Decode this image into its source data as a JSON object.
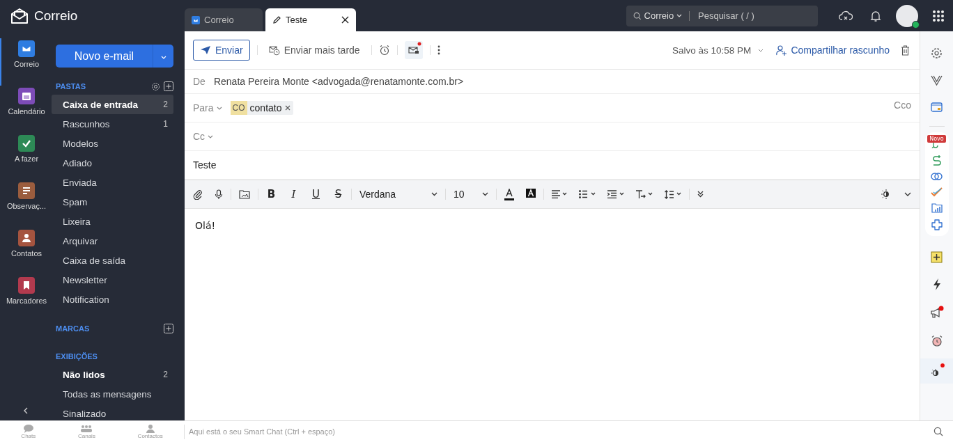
{
  "app": {
    "title": "Correio"
  },
  "tabs": [
    {
      "label": "Correio",
      "kind": "app",
      "selected": false
    },
    {
      "label": "Teste",
      "kind": "draft",
      "selected": true
    }
  ],
  "search": {
    "scope": "Correio",
    "placeholder": "Pesquisar ( / )"
  },
  "nav": [
    {
      "label": "Correio",
      "kind": "mail",
      "color": "#2f7de1",
      "selected": true
    },
    {
      "label": "Calendário",
      "kind": "calendar",
      "color": "#7d4cb8",
      "selected": false
    },
    {
      "label": "A fazer",
      "kind": "todo",
      "color": "#2d8a56",
      "selected": false
    },
    {
      "label": "Observaç...",
      "kind": "notes",
      "color": "#9b5d3e",
      "selected": false
    },
    {
      "label": "Contatos",
      "kind": "contacts",
      "color": "#a5543f",
      "selected": false
    },
    {
      "label": "Marcadores",
      "kind": "bookmarks",
      "color": "#b23a4e",
      "selected": false
    }
  ],
  "new_button": "Novo e-mail",
  "folders": {
    "title": "PASTAS",
    "items": [
      {
        "label": "Caixa de entrada",
        "count": "2",
        "unread": true,
        "selected": true
      },
      {
        "label": "Rascunhos",
        "count": "1",
        "unread": false,
        "selected": false
      },
      {
        "label": "Modelos",
        "unread": false,
        "selected": false
      },
      {
        "label": "Adiado",
        "unread": false,
        "selected": false
      },
      {
        "label": "Enviada",
        "unread": false,
        "selected": false
      },
      {
        "label": "Spam",
        "unread": false,
        "selected": false
      },
      {
        "label": "Lixeira",
        "unread": false,
        "selected": false
      },
      {
        "label": "Arquivar",
        "unread": false,
        "selected": false
      },
      {
        "label": "Caixa de saída",
        "unread": false,
        "selected": false
      },
      {
        "label": "Newsletter",
        "unread": false,
        "selected": false
      },
      {
        "label": "Notification",
        "unread": false,
        "selected": false
      }
    ]
  },
  "tags": {
    "title": "MARCAS"
  },
  "views": {
    "title": "EXIBIÇÕES",
    "items": [
      {
        "label": "Não lidos",
        "count": "2",
        "unread": true,
        "selected": false
      },
      {
        "label": "Todas as mensagens",
        "unread": false,
        "selected": false
      },
      {
        "label": "Sinalizado",
        "unread": false,
        "selected": false
      }
    ]
  },
  "toolbar": {
    "send": "Enviar",
    "send_later": "Enviar mais tarde",
    "saved": "Salvo às 10:58 PM",
    "share": "Compartilhar rascunho"
  },
  "compose": {
    "from_label": "De",
    "from": "Renata Pereira Monte <advogada@renatamonte.com.br>",
    "to_label": "Para",
    "recipients": [
      {
        "initials": "CO",
        "name": "contato"
      }
    ],
    "bcc": "Cco",
    "cc_label": "Cc",
    "subject": "Teste",
    "body": "Olá!"
  },
  "format": {
    "styles": [
      {
        "label": "B",
        "kind": "bold"
      },
      {
        "label": "I",
        "kind": "italic"
      },
      {
        "label": "U",
        "kind": "underline"
      },
      {
        "label": "S",
        "kind": "strike"
      }
    ],
    "font": "Verdana",
    "size": "10"
  },
  "rail_badge": "Novo",
  "chat_tabs": [
    "Chats",
    "Canais",
    "Contactos"
  ],
  "smart_chat": {
    "placeholder": "Aqui está o seu Smart Chat (Ctrl + espaço)"
  }
}
